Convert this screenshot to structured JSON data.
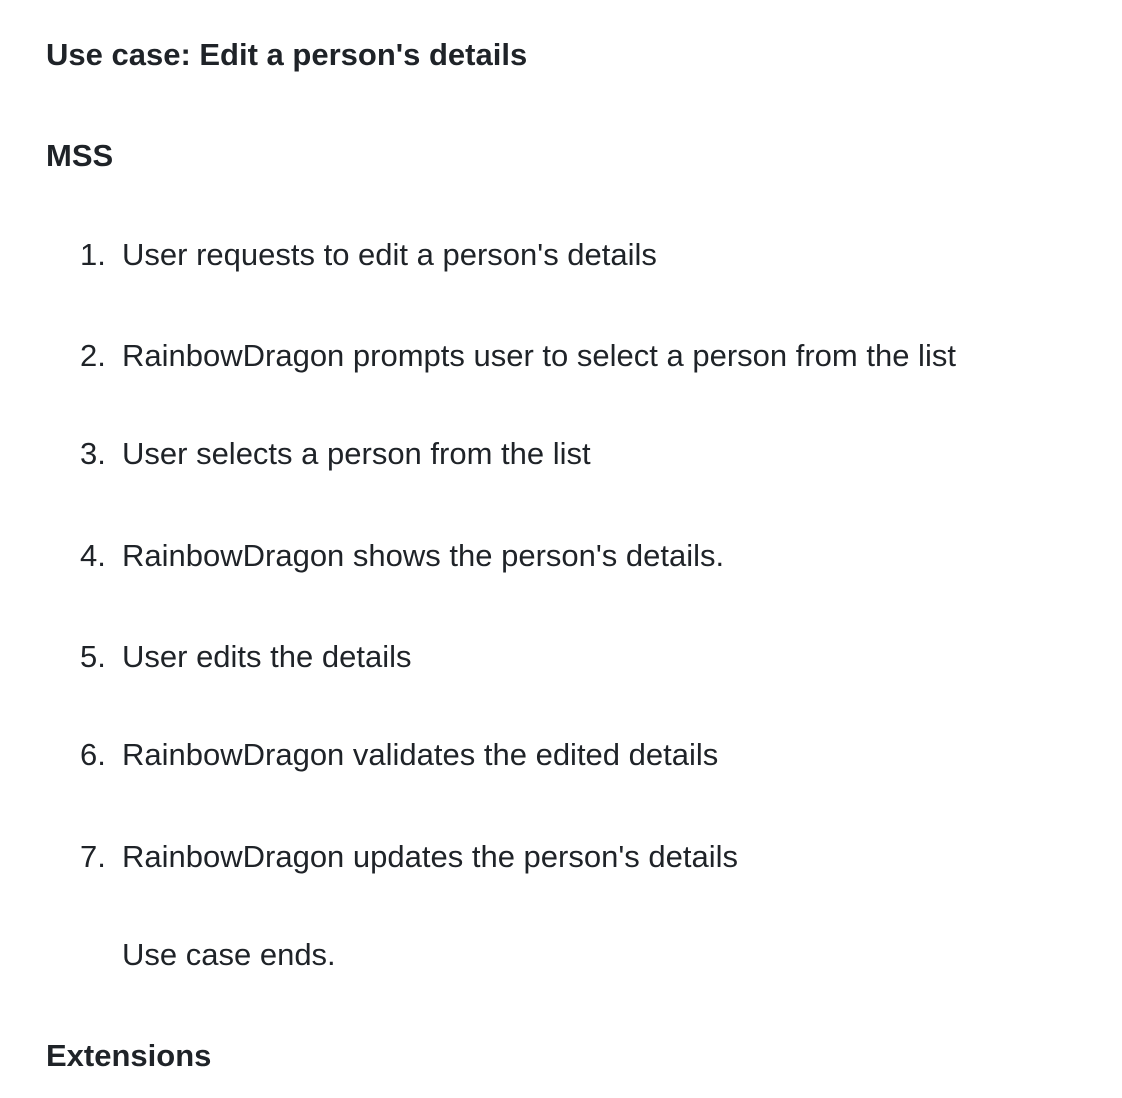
{
  "usecase_title": "Use case: Edit a person's details",
  "mss_heading": "MSS",
  "steps": [
    {
      "num": "1.",
      "text": "User requests to edit a person's details"
    },
    {
      "num": "2.",
      "text": "RainbowDragon prompts user to select a person from the list"
    },
    {
      "num": "3.",
      "text": "User selects a person from the list"
    },
    {
      "num": "4.",
      "text": "RainbowDragon shows the person's details."
    },
    {
      "num": "5.",
      "text": "User edits the details"
    },
    {
      "num": "6.",
      "text": "RainbowDragon validates the edited details"
    },
    {
      "num": "7.",
      "text": "RainbowDragon updates the person's details"
    }
  ],
  "use_case_ends": "Use case ends.",
  "extensions_heading": "Extensions"
}
